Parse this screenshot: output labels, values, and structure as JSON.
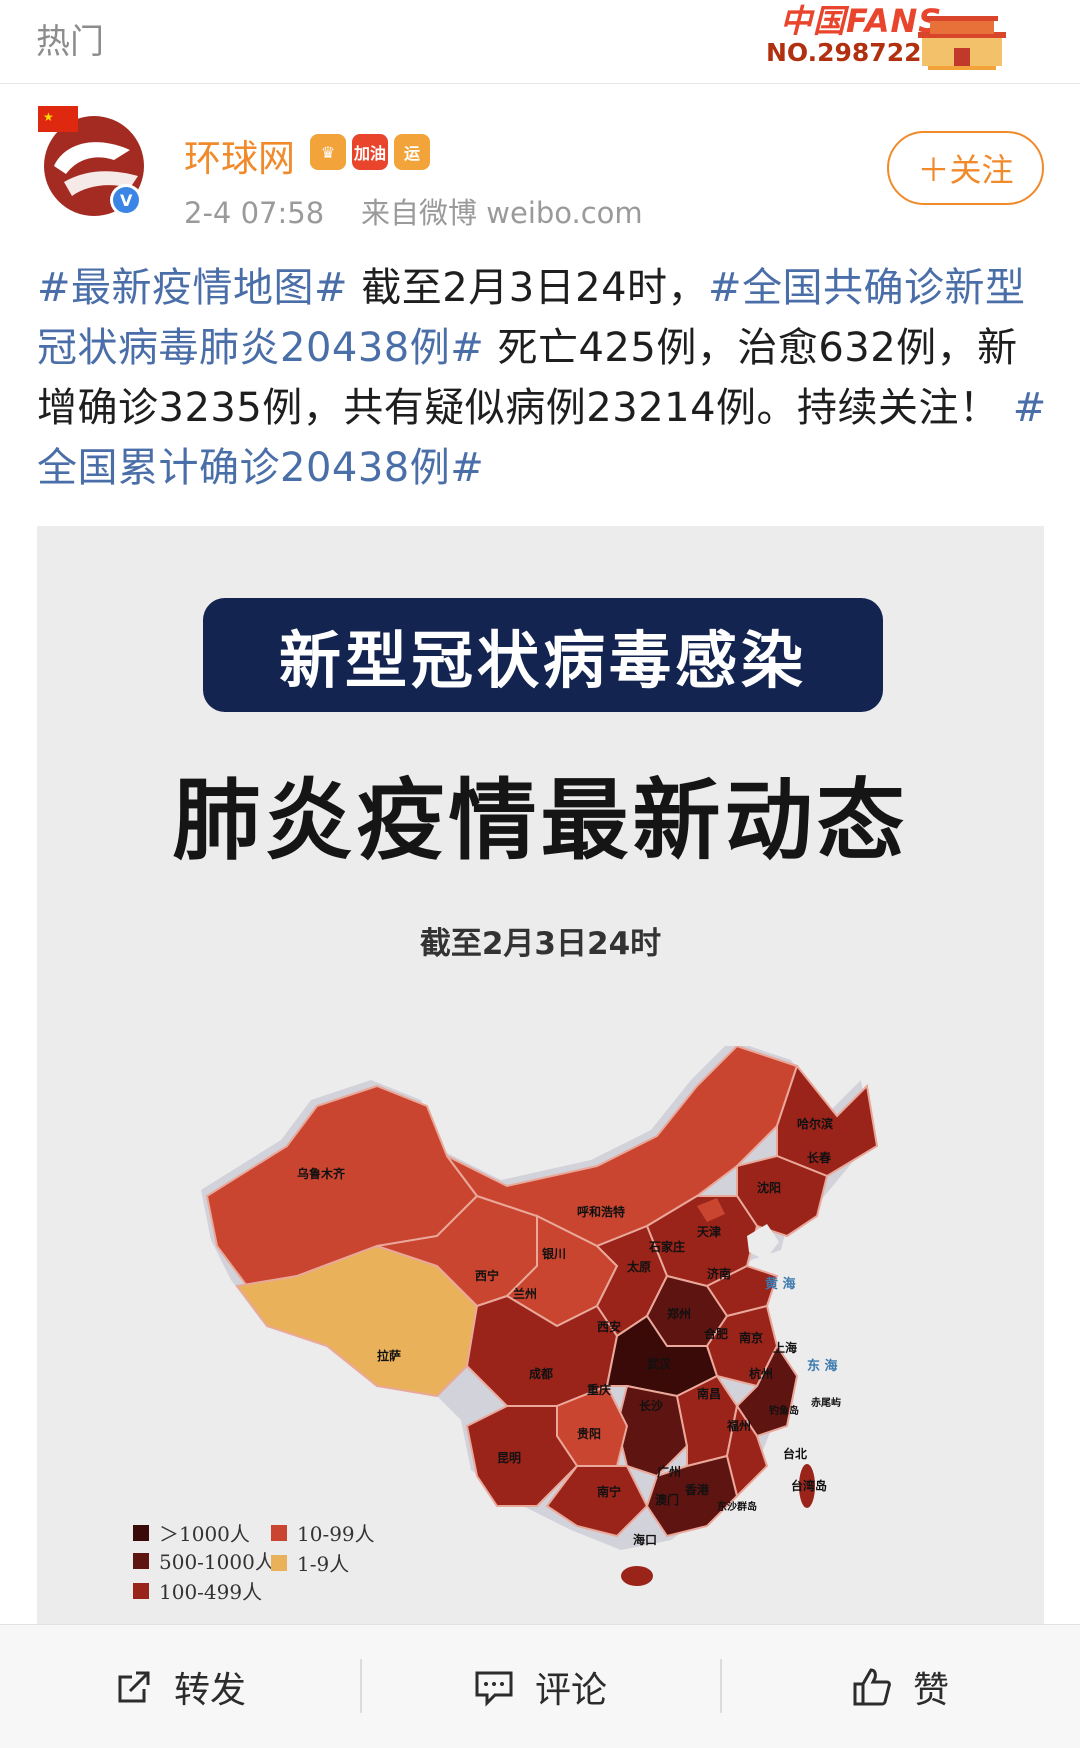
{
  "topbar": {
    "title": "热门",
    "fans_logo": "中国FANS",
    "fans_number": "NO.2987224"
  },
  "post": {
    "author": "环球网",
    "badges": [
      {
        "name": "crown-badge-icon",
        "color": "#f2a43a",
        "text": ""
      },
      {
        "name": "jiayou-badge-icon",
        "color": "#e8452c",
        "text": "加油"
      },
      {
        "name": "yun-badge-icon",
        "color": "#f2a43a",
        "text": "运"
      }
    ],
    "timestamp": "2-4 07:58",
    "source": "来自微博 weibo.com",
    "follow_label": "＋关注",
    "text_segments": [
      {
        "text": "#最新疫情地图#",
        "tag": true
      },
      {
        "text": " 截至2月3日24时，",
        "tag": false
      },
      {
        "text": "#全国共确诊新型冠状病毒肺炎20438例#",
        "tag": true
      },
      {
        "text": " 死亡425例，治愈632例，新增确诊3235例，共有疑似病例23214例。持续关注！ ",
        "tag": false
      },
      {
        "text": "#全国累计确诊20438例#",
        "tag": true
      }
    ]
  },
  "image": {
    "banner": "新型冠状病毒感染",
    "headline": "肺炎疫情最新动态",
    "asof": "截至2月3日24时",
    "map_labels": {
      "urumqi": "乌鲁木齐",
      "lhasa": "拉萨",
      "xining": "西宁",
      "lanzhou": "兰州",
      "yinchuan": "银川",
      "hohhot": "呼和浩特",
      "harbin": "哈尔滨",
      "changchun": "长春",
      "shenyang": "沈阳",
      "tianjin": "天津",
      "shijiazhuang": "石家庄",
      "taiyuan": "太原",
      "jinan": "济南",
      "xian": "西安",
      "zhengzhou": "郑州",
      "hefei": "合肥",
      "nanjing": "南京",
      "shanghai": "上海",
      "wuhan": "武汉",
      "hangzhou": "杭州",
      "chengdu": "成都",
      "chongqing": "重庆",
      "changsha": "长沙",
      "nanchang": "南昌",
      "fuzhou": "福州",
      "guiyang": "贵阳",
      "kunming": "昆明",
      "nanning": "南宁",
      "guangzhou": "广州",
      "macau": "澳门",
      "hongkong": "香港",
      "haikou": "海口",
      "taipei": "台北",
      "taiwan": "台湾岛",
      "yellow_sea": "黄 海",
      "east_sea": "东 海",
      "diaoyu": "钓鱼岛",
      "chiwei": "赤尾屿",
      "dongsha": "东沙群岛"
    },
    "legend": [
      {
        "label": "＞1000人",
        "color": "#3a0a08"
      },
      {
        "label": "500-1000人",
        "color": "#5e1410"
      },
      {
        "label": "100-499人",
        "color": "#9a231a"
      },
      {
        "label": "10-99人",
        "color": "#c9452f"
      },
      {
        "label": "1-9人",
        "color": "#e9b25a"
      }
    ]
  },
  "actions": {
    "repost": "转发",
    "comment": "评论",
    "like": "赞"
  }
}
